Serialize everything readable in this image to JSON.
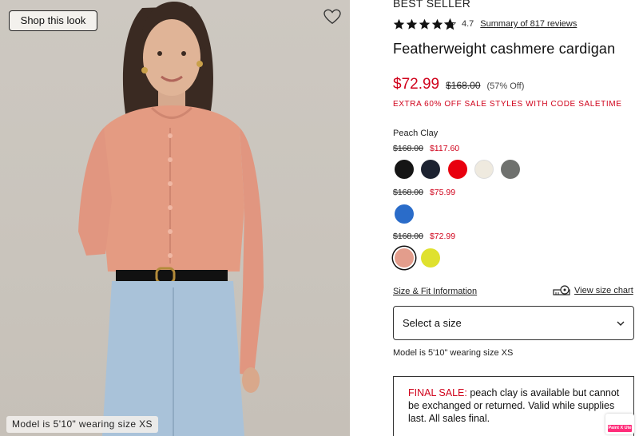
{
  "image": {
    "shop_look_label": "Shop this look",
    "model_caption": "Model is 5'10\" wearing size XS"
  },
  "product": {
    "badge": "BEST SELLER",
    "rating": "4.7",
    "rating_value": 4.7,
    "reviews_label": "Summary of 817 reviews",
    "title": "Featherweight cashmere cardigan",
    "sale_price": "$72.99",
    "original_price": "$168.00",
    "discount": "(57% Off)",
    "promo": "EXTRA 60% OFF SALE STYLES WITH CODE SALETIME",
    "selected_color": "Peach Clay"
  },
  "price_tiers": [
    {
      "old": "$168.00",
      "new": "$117.60",
      "swatches": [
        {
          "name": "black",
          "color": "#151515"
        },
        {
          "name": "navy",
          "color": "#1c2230"
        },
        {
          "name": "red",
          "color": "#e8000e"
        },
        {
          "name": "ivory",
          "color": "#efeadf"
        },
        {
          "name": "grey",
          "color": "#6f716e"
        }
      ]
    },
    {
      "old": "$168.00",
      "new": "$75.99",
      "swatches": [
        {
          "name": "blue",
          "color": "#2a6cc9"
        }
      ]
    },
    {
      "old": "$168.00",
      "new": "$72.99",
      "swatches": [
        {
          "name": "peach-clay",
          "color": "#e39d8c",
          "selected": true
        },
        {
          "name": "yellow",
          "color": "#dfe12e"
        }
      ]
    }
  ],
  "size": {
    "fit_link": "Size & Fit Information",
    "chart_link": "View size chart",
    "select_label": "Select a size",
    "model_note": "Model is 5'10\" wearing size XS"
  },
  "final_sale": {
    "label": "FINAL SALE:",
    "text": " peach clay is available but cannot be exchanged or returned. Valid while supplies last. All sales final."
  },
  "extension": {
    "label": "Paint X Ute"
  },
  "colors": {
    "accent_red": "#d0021b",
    "text": "#111111"
  }
}
